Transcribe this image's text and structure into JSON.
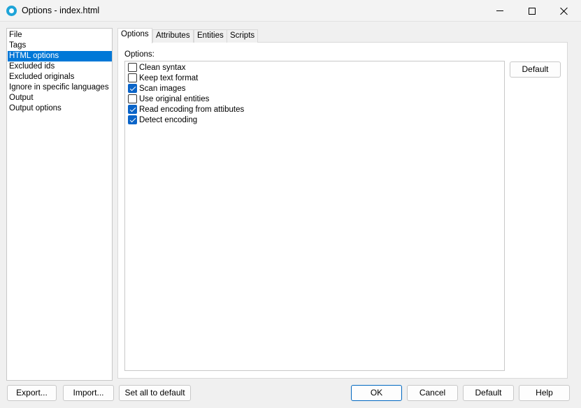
{
  "window": {
    "title": "Options - index.html"
  },
  "sidebar": {
    "items": [
      {
        "label": "File"
      },
      {
        "label": "Tags"
      },
      {
        "label": "HTML options"
      },
      {
        "label": "Excluded ids"
      },
      {
        "label": "Excluded originals"
      },
      {
        "label": "Ignore in specific languages"
      },
      {
        "label": "Output"
      },
      {
        "label": "Output options"
      }
    ],
    "selected": "HTML options"
  },
  "tabs": [
    {
      "label": "Options",
      "active": true
    },
    {
      "label": "Attributes",
      "active": false
    },
    {
      "label": "Entities",
      "active": false
    },
    {
      "label": "Scripts",
      "active": false
    }
  ],
  "options_panel": {
    "label": "Options:",
    "checkboxes": [
      {
        "label": "Clean syntax",
        "checked": false
      },
      {
        "label": "Keep text format",
        "checked": false
      },
      {
        "label": "Scan images",
        "checked": true
      },
      {
        "label": "Use original entities",
        "checked": false
      },
      {
        "label": "Read encoding from attibutes",
        "checked": true
      },
      {
        "label": "Detect encoding",
        "checked": true
      }
    ],
    "default_button": "Default"
  },
  "footer": {
    "export": "Export...",
    "import": "Import...",
    "set_all_default": "Set all to default",
    "ok": "OK",
    "cancel": "Cancel",
    "default": "Default",
    "help": "Help"
  },
  "colors": {
    "selection": "#0078d7",
    "checkbox_checked": "#0a64c8",
    "primary_border": "#0067c0"
  }
}
